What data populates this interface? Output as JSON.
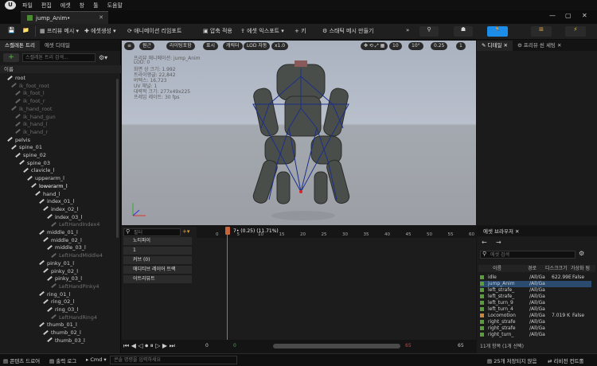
{
  "menu": [
    "파일",
    "편집",
    "에셋",
    "창",
    "툴",
    "도움말"
  ],
  "tab": {
    "title": "jump_Anim•",
    "close": "✕"
  },
  "toolbar": {
    "items": [
      "프리뷰 메시",
      "에셋생성",
      "애니메이션 리임포트",
      "압축 적용",
      "에셋 익스포트",
      "키",
      "스태틱 메시 만들기"
    ]
  },
  "left": {
    "tabs": [
      "스켈레톤 트리",
      "에셋 디테일"
    ],
    "search_placeholder": "스켈레톤 트리 검색...",
    "header": "이름",
    "bones": [
      {
        "name": "root",
        "dim": false
      },
      {
        "name": "ik_foot_root",
        "dim": true
      },
      {
        "name": "ik_foot_l",
        "dim": true
      },
      {
        "name": "ik_foot_r",
        "dim": true
      },
      {
        "name": "ik_hand_root",
        "dim": true
      },
      {
        "name": "ik_hand_gun",
        "dim": true
      },
      {
        "name": "ik_hand_l",
        "dim": true
      },
      {
        "name": "ik_hand_r",
        "dim": true
      },
      {
        "name": "pelvis",
        "dim": false
      },
      {
        "name": "spine_01",
        "dim": false
      },
      {
        "name": "spine_02",
        "dim": false
      },
      {
        "name": "spine_03",
        "dim": false
      },
      {
        "name": "clavicle_l",
        "dim": false
      },
      {
        "name": "upperarm_l",
        "dim": false
      },
      {
        "name": "lowerarm_l",
        "dim": false
      },
      {
        "name": "hand_l",
        "dim": false
      },
      {
        "name": "index_01_l",
        "dim": false
      },
      {
        "name": "index_02_l",
        "dim": false
      },
      {
        "name": "index_03_l",
        "dim": false
      },
      {
        "name": "LeftHandIndex4",
        "dim": true
      },
      {
        "name": "middle_01_l",
        "dim": false
      },
      {
        "name": "middle_02_l",
        "dim": false
      },
      {
        "name": "middle_03_l",
        "dim": false
      },
      {
        "name": "LeftHandMiddle4",
        "dim": true
      },
      {
        "name": "pinky_01_l",
        "dim": false
      },
      {
        "name": "pinky_02_l",
        "dim": false
      },
      {
        "name": "pinky_03_l",
        "dim": false
      },
      {
        "name": "LeftHandPinky4",
        "dim": true
      },
      {
        "name": "ring_01_l",
        "dim": false
      },
      {
        "name": "ring_02_l",
        "dim": false
      },
      {
        "name": "ring_03_l",
        "dim": false
      },
      {
        "name": "LeftHandRing4",
        "dim": true
      },
      {
        "name": "thumb_01_l",
        "dim": false
      },
      {
        "name": "thumb_02_l",
        "dim": false
      },
      {
        "name": "thumb_03_l",
        "dim": false
      }
    ]
  },
  "viewport": {
    "buttons": [
      "원근",
      "라이팅포함",
      "표시",
      "캐릭터",
      "LOD 자동",
      "x1.0"
    ],
    "stats": [
      "프리뷰 애니메이션: jump_Anim",
      "LOD: 0",
      "화면 상 크기: 1.992",
      "트라이앵글: 22,842",
      "버텍스: 16,723",
      "UV 채널: 1",
      "대략적 크기: 277x49x225",
      "프레임 레이트: 30 fps"
    ],
    "right_nums": [
      "10",
      "10°",
      "0.25",
      "1"
    ]
  },
  "right": {
    "tabs": [
      "디테일",
      "프리뷰 씬 세팅"
    ]
  },
  "timeline": {
    "filter": "필터",
    "frame": "7• (0.25) (11.71%)",
    "tracks": [
      "노티파이",
      "1",
      "커브 (0)",
      "애디티브 레이어 트랙",
      "어트리뷰트"
    ],
    "ruler": [
      "0",
      "5",
      "10",
      "15",
      "20",
      "25",
      "30",
      "35",
      "40",
      "45",
      "50",
      "55",
      "60",
      "65"
    ],
    "bottom": [
      "0",
      "0",
      "65",
      "65"
    ]
  },
  "assets": {
    "title": "에셋 브라우저",
    "search_placeholder": "에셋 검색",
    "cols": [
      "이름",
      "경로",
      "디스크크기",
      "가상화 됨"
    ],
    "rows": [
      {
        "name": "idle",
        "path": "/All/Ga",
        "size": "622.99E",
        "virt": "False",
        "color": "#5a9e3a"
      },
      {
        "name": "jump_Anim",
        "path": "/All/Ga",
        "size": "",
        "virt": "",
        "color": "#5a9e3a"
      },
      {
        "name": "left_strafe_",
        "path": "/All/Ga",
        "size": "",
        "virt": "",
        "color": "#5a9e3a"
      },
      {
        "name": "left_strafe_",
        "path": "/All/Ga",
        "size": "",
        "virt": "",
        "color": "#5a9e3a"
      },
      {
        "name": "left_turn_9",
        "path": "/All/Ga",
        "size": "",
        "virt": "",
        "color": "#5a9e3a"
      },
      {
        "name": "left_turn_4",
        "path": "/All/Ga",
        "size": "",
        "virt": "",
        "color": "#5a9e3a"
      },
      {
        "name": "Locomotion",
        "path": "/All/Ga",
        "size": "7.019 K",
        "virt": "False",
        "color": "#c9853c"
      },
      {
        "name": "right_strafe",
        "path": "/All/Ga",
        "size": "",
        "virt": "",
        "color": "#5a9e3a"
      },
      {
        "name": "right_strafe",
        "path": "/All/Ga",
        "size": "",
        "virt": "",
        "color": "#5a9e3a"
      },
      {
        "name": "right_turn_",
        "path": "/All/Ga",
        "size": "",
        "virt": "",
        "color": "#5a9e3a"
      }
    ],
    "footer": "11개 항목 (1개 선택)"
  },
  "status": {
    "drawer": "콘텐츠 드로어",
    "log": "출력 로그",
    "cmd": "Cmd",
    "console": "콘솔 명령을 입력하세요",
    "unsaved": "25개 저장되지 않음",
    "revision": "리비전 컨트롤"
  },
  "colors": {
    "accent": "#1c8de8",
    "selected": "#2a4a6e"
  }
}
